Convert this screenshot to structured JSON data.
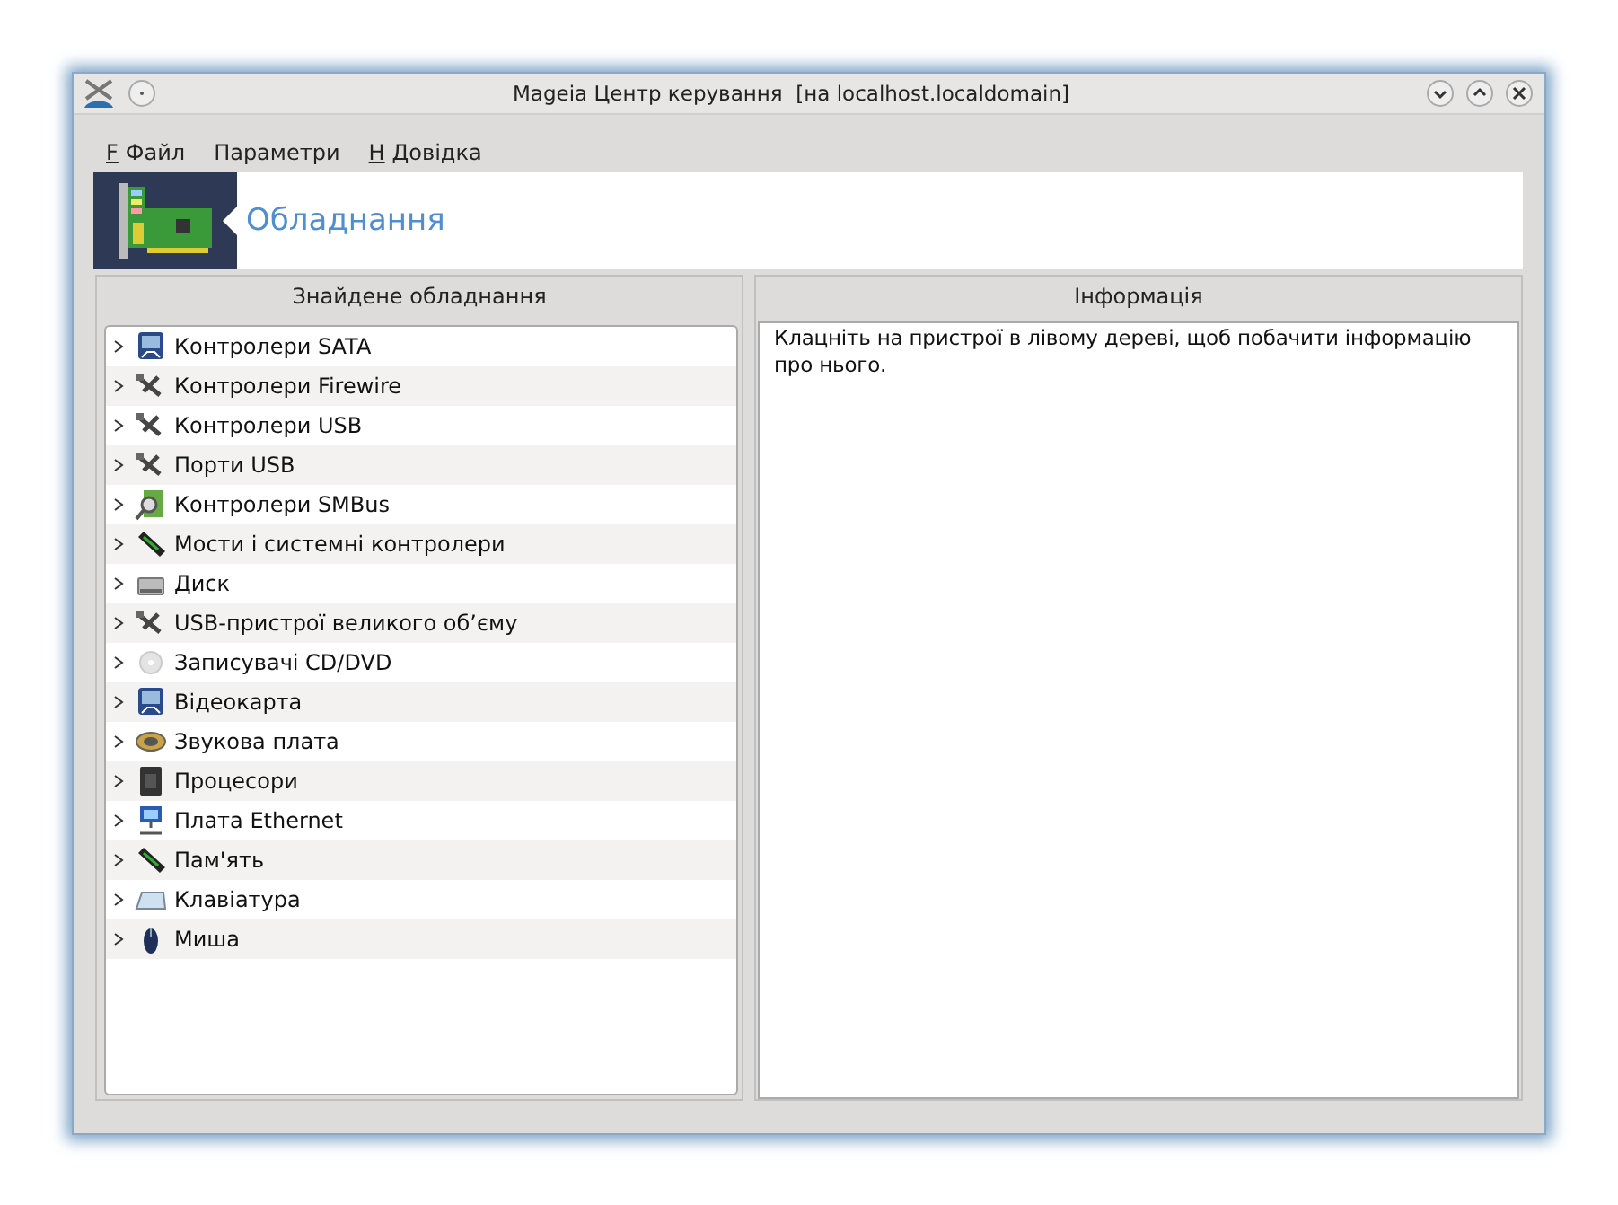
{
  "window": {
    "title": "Mageia Центр керування  [на localhost.localdomain]"
  },
  "menu": [
    {
      "mnemonic": "F",
      "label": "Файл"
    },
    {
      "label": "Параметри"
    },
    {
      "mnemonic": "H",
      "label": "Довідка"
    }
  ],
  "header": {
    "title": "Обладнання"
  },
  "tree": {
    "heading": "Знайдене обладнання",
    "items": [
      {
        "label": "Контролери SATA",
        "expanded": false
      },
      {
        "label": "Контролери Firewire",
        "expanded": false
      },
      {
        "label": "Контролери USB",
        "expanded": false
      },
      {
        "label": "Порти USB",
        "expanded": false
      },
      {
        "label": "Контролери SMBus",
        "expanded": false
      },
      {
        "label": "Мости і системні контролери",
        "expanded": false
      },
      {
        "label": "Диск",
        "expanded": false
      },
      {
        "label": "USB-пристрої великого об’єму",
        "expanded": false
      },
      {
        "label": "Записувачі CD/DVD",
        "expanded": false
      },
      {
        "label": "Відеокарта",
        "expanded": false
      },
      {
        "label": "Звукова плата",
        "expanded": false
      },
      {
        "label": "Процесори",
        "expanded": false
      },
      {
        "label": "Плата Ethernet",
        "expanded": false
      },
      {
        "label": "Пам'ять",
        "expanded": false
      },
      {
        "label": "Клавіатура",
        "expanded": false
      },
      {
        "label": "Миша",
        "expanded": false
      }
    ]
  },
  "info": {
    "heading": "Інформація",
    "text": "Клацніть на пристрої в лівому дереві, щоб побачити інформацію про нього."
  }
}
